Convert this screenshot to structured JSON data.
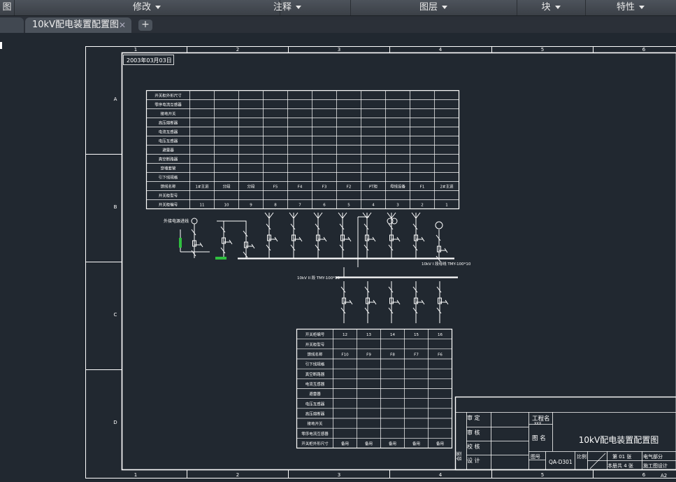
{
  "menubar": {
    "items": [
      "图",
      "修改",
      "注释",
      "图层",
      "块",
      "特性"
    ]
  },
  "tabs": {
    "active": "10kV配电装置配置图",
    "close": "✕",
    "new": "+"
  },
  "drawing": {
    "date": "2003年03月03日",
    "col_marks": [
      "1",
      "2",
      "3",
      "4",
      "5",
      "6"
    ],
    "row_marks": [
      "A",
      "B",
      "C",
      "D"
    ],
    "title_block": {
      "review": "审 定",
      "check": "审 核",
      "proof": "校 核",
      "design": "设 计",
      "project_label": "工程名",
      "project_value": "XXX",
      "name_label": "图 名",
      "drawing_title": "10kV配电装置配置图",
      "no_label": "图号",
      "no_value": "QA-D301",
      "scale_label": "比例",
      "sheet": "第 01 张",
      "total": "本册共 4 张",
      "dept": "电气部分",
      "dept2": "施工图设计",
      "side": "会签",
      "corner": "A2"
    },
    "bus_label_top": "10kV I 段母线 TMY-100*10",
    "bus_label_lower": "10kV II 段 TMY-100*10",
    "incoming_label": "外接电源进线",
    "upper_table": {
      "headers": [
        "开关柜外形尺寸",
        "零序电流互感器",
        "接地开关",
        "高压熔断器",
        "电流互感器",
        "电压互感器",
        "避雷器",
        "真空断路器",
        "穿墙套管",
        "引下线规格",
        "馈线名称",
        "开关柜型号",
        "开关柜编号"
      ],
      "feeder_names": [
        "1#主进",
        "分段",
        "分段",
        "F5",
        "F4",
        "F3",
        "F2",
        "PT柜",
        "母线设备",
        "F1",
        "2#主进"
      ],
      "cabinet_numbers": [
        "11",
        "10",
        "9",
        "8",
        "7",
        "6",
        "5",
        "4",
        "3",
        "2",
        "1"
      ]
    },
    "lower_table": {
      "headers": [
        "开关柜编号",
        "开关柜型号",
        "馈线名称",
        "引下线规格",
        "真空断路器",
        "电流互感器",
        "避雷器",
        "电压互感器",
        "高压熔断器",
        "接地开关",
        "零序电流互感器",
        "开关柜外形尺寸"
      ],
      "cabinet_numbers": [
        "12",
        "13",
        "14",
        "15",
        "16"
      ],
      "feeder_names": [
        "F10",
        "F9",
        "F8",
        "F7",
        "F6"
      ],
      "spare": "备用"
    }
  }
}
